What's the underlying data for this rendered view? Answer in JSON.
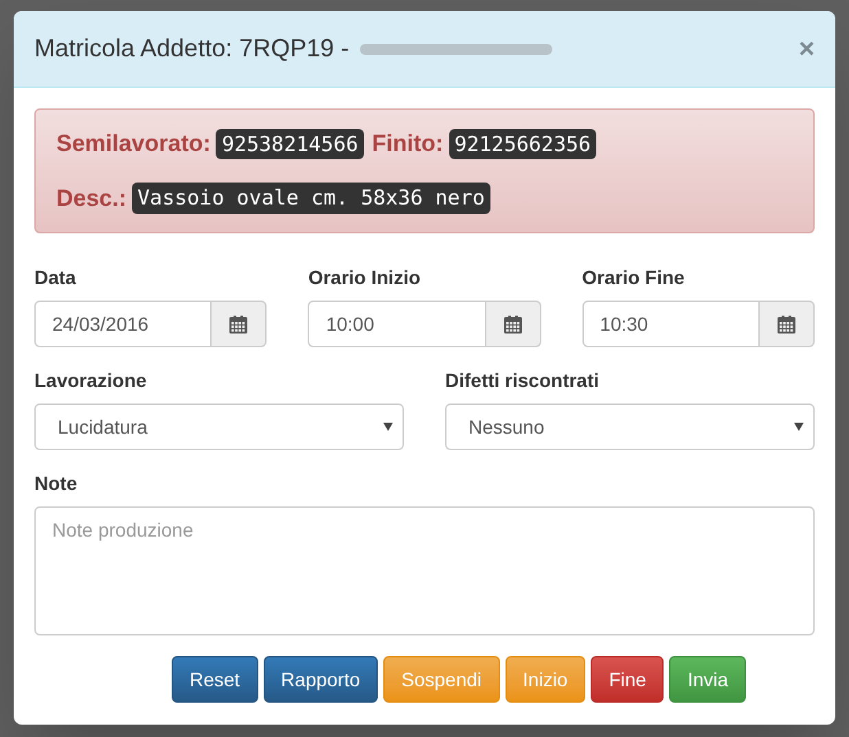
{
  "modal": {
    "title": "Matricola Addetto: 7RQP19 -",
    "close": "×"
  },
  "alert": {
    "semi_label": "Semilavorato:",
    "semi_value": "92538214566",
    "finito_label": "Finito:",
    "finito_value": "92125662356",
    "desc_label": "Desc.:",
    "desc_value": "Vassoio ovale cm. 58x36 nero"
  },
  "date_fields": [
    {
      "label": "Data",
      "value": "24/03/2016"
    },
    {
      "label": "Orario Inizio",
      "value": "10:00"
    },
    {
      "label": "Orario Fine",
      "value": "10:30"
    }
  ],
  "selects": [
    {
      "label": "Lavorazione",
      "value": "Lucidatura"
    },
    {
      "label": "Difetti riscontrati",
      "value": "Nessuno"
    }
  ],
  "note": {
    "label": "Note",
    "placeholder": "Note produzione"
  },
  "buttons": [
    {
      "label": "Reset",
      "kind": "primary"
    },
    {
      "label": "Rapporto",
      "kind": "primary"
    },
    {
      "label": "Sospendi",
      "kind": "warning"
    },
    {
      "label": "Inizio",
      "kind": "warning"
    },
    {
      "label": "Fine",
      "kind": "danger"
    },
    {
      "label": "Invia",
      "kind": "success"
    }
  ]
}
